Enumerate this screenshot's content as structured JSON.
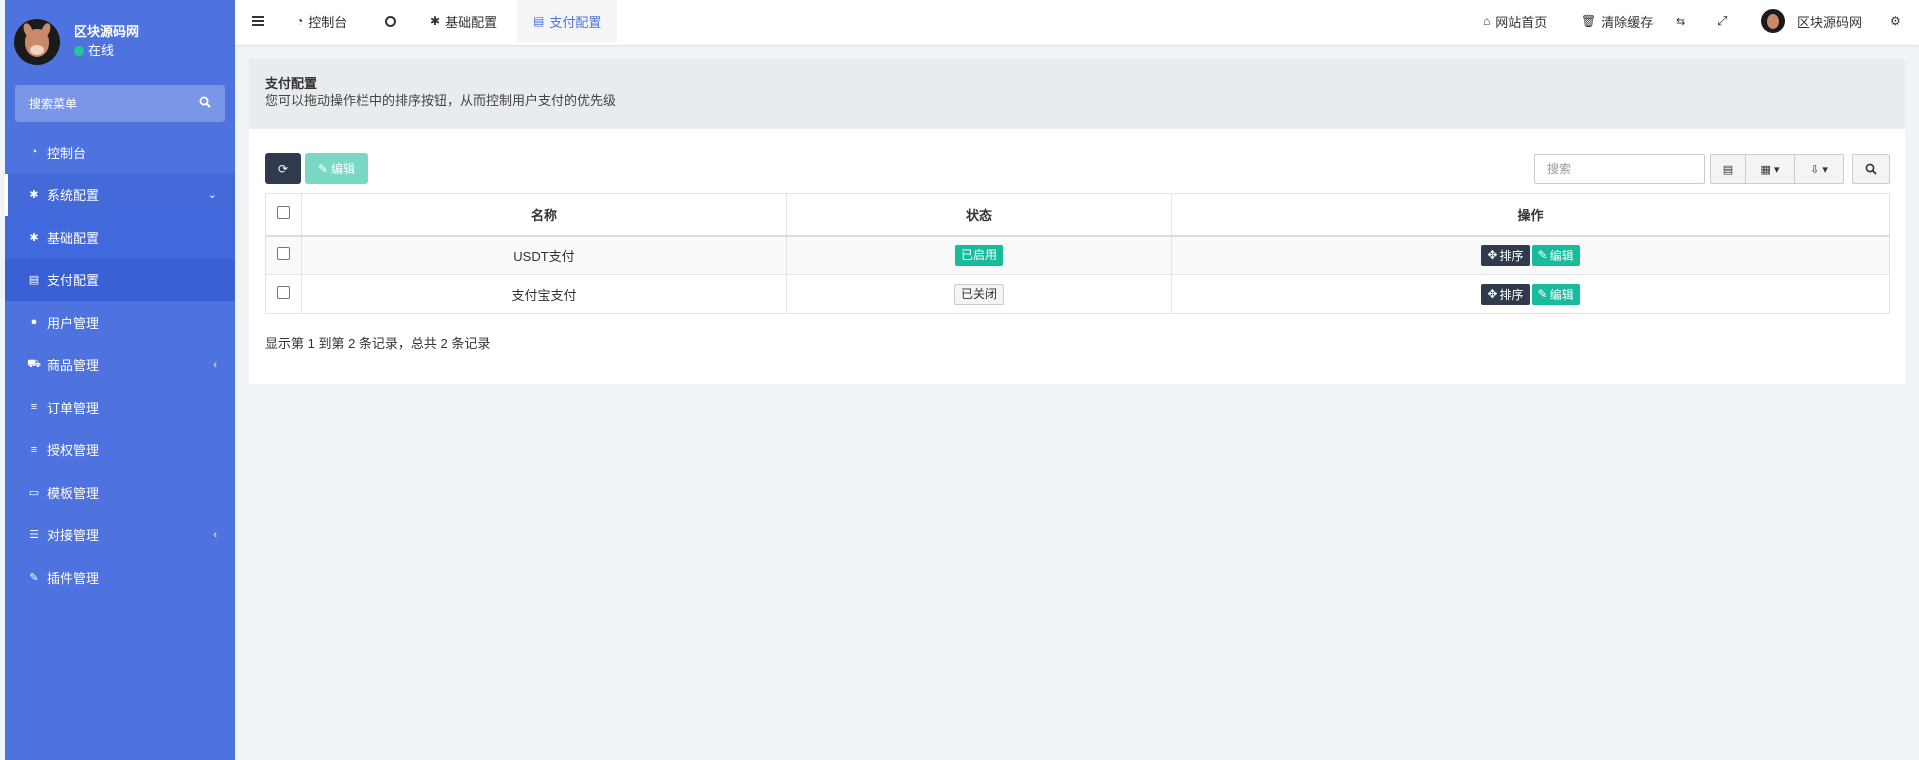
{
  "sidebar": {
    "user_name": "区块源码网",
    "user_status": "在线",
    "search_placeholder": "搜索菜单",
    "items": [
      {
        "label": "控制台",
        "icon": "dashboard-icon"
      },
      {
        "label": "系统配置",
        "icon": "gear-icon"
      },
      {
        "label": "基础配置",
        "icon": "gear-icon"
      },
      {
        "label": "支付配置",
        "icon": "table-icon"
      },
      {
        "label": "用户管理",
        "icon": "user-icon"
      },
      {
        "label": "商品管理",
        "icon": "cart-icon"
      },
      {
        "label": "订单管理",
        "icon": "list-icon"
      },
      {
        "label": "授权管理",
        "icon": "list-icon"
      },
      {
        "label": "模板管理",
        "icon": "template-icon"
      },
      {
        "label": "对接管理",
        "icon": "sliders-icon"
      },
      {
        "label": "插件管理",
        "icon": "plug-icon"
      }
    ]
  },
  "topbar": {
    "tabs": [
      {
        "label": "控制台"
      },
      {
        "label": "基础配置"
      },
      {
        "label": "支付配置"
      }
    ],
    "site_home": "网站首页",
    "clear_cache": "清除缓存",
    "user_name": "区块源码网"
  },
  "panel": {
    "title": "支付配置",
    "description": "您可以拖动操作栏中的排序按钮，从而控制用户支付的优先级",
    "edit_label": "编辑",
    "search_placeholder": "搜索"
  },
  "table": {
    "headers": {
      "name": "名称",
      "status": "状态",
      "action": "操作"
    },
    "rows": [
      {
        "name": "USDT支付",
        "status": "已启用",
        "enabled": true
      },
      {
        "name": "支付宝支付",
        "status": "已关闭",
        "enabled": false
      }
    ],
    "sort_label": "排序",
    "edit_label": "编辑"
  },
  "pager": {
    "summary": "显示第 1 到第 2 条记录，总共 2 条记录"
  },
  "colors": {
    "sidebar": "#4e73df",
    "primary_dark": "#2f3b4c",
    "success": "#18bc9c"
  }
}
